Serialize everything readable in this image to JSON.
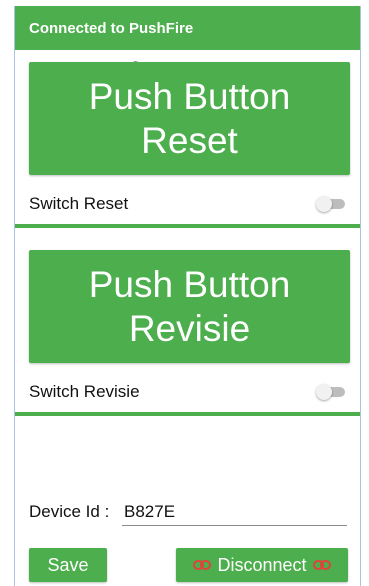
{
  "header": {
    "title": "Connected to PushFire"
  },
  "reset": {
    "button_label": "Push Button\nReset",
    "switch_label": "Switch Reset",
    "switch_on": false
  },
  "revisie": {
    "button_label": "Push Button\nRevisie",
    "switch_label": "Switch Revisie",
    "switch_on": false
  },
  "device": {
    "label": "Device Id :",
    "value": "B827E"
  },
  "actions": {
    "save_label": "Save",
    "disconnect_label": "Disconnect",
    "disconnect_icon": "link-icon"
  },
  "colors": {
    "accent": "#4cae4c",
    "link_icon": "#e0433a"
  }
}
